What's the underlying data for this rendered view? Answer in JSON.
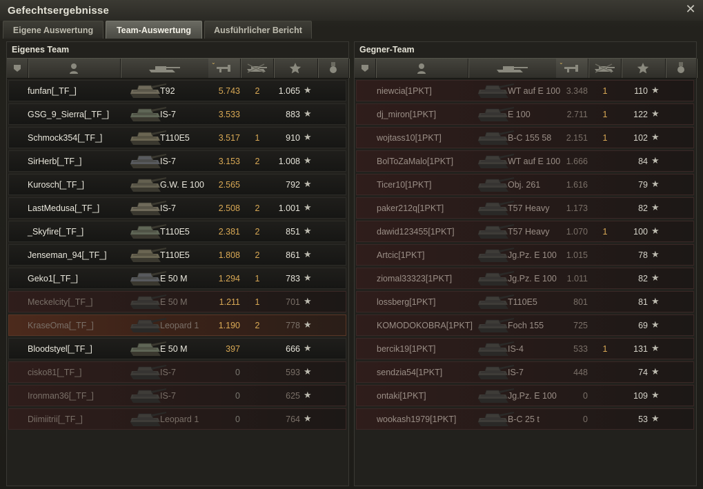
{
  "window": {
    "title": "Gefechtsergebnisse",
    "close_glyph": "✕"
  },
  "tabs": [
    {
      "label": "Eigene Auswertung",
      "active": false
    },
    {
      "label": "Team-Auswertung",
      "active": true
    },
    {
      "label": "Ausführlicher Bericht",
      "active": false
    }
  ],
  "own_team": {
    "title": "Eigenes Team",
    "rows": [
      {
        "name": "funfan[_TF_]",
        "vehicle": "T92",
        "damage": "5.743",
        "kills": "2",
        "xp": "1.065",
        "state": "alive"
      },
      {
        "name": "GSG_9_Sierra[_TF_]",
        "vehicle": "IS-7",
        "damage": "3.533",
        "kills": "",
        "xp": "883",
        "state": "alive"
      },
      {
        "name": "Schmock354[_TF_]",
        "vehicle": "T110E5",
        "damage": "3.517",
        "kills": "1",
        "xp": "910",
        "state": "alive"
      },
      {
        "name": "SirHerb[_TF_]",
        "vehicle": "IS-7",
        "damage": "3.153",
        "kills": "2",
        "xp": "1.008",
        "state": "alive"
      },
      {
        "name": "Kurosch[_TF_]",
        "vehicle": "G.W. E 100",
        "damage": "2.565",
        "kills": "",
        "xp": "792",
        "state": "alive"
      },
      {
        "name": "LastMedusa[_TF_]",
        "vehicle": "IS-7",
        "damage": "2.508",
        "kills": "2",
        "xp": "1.001",
        "state": "alive"
      },
      {
        "name": "_Skyfire[_TF_]",
        "vehicle": "T110E5",
        "damage": "2.381",
        "kills": "2",
        "xp": "851",
        "state": "alive"
      },
      {
        "name": "Jenseman_94[_TF_]",
        "vehicle": "T110E5",
        "damage": "1.808",
        "kills": "2",
        "xp": "861",
        "state": "alive"
      },
      {
        "name": "Geko1[_TF_]",
        "vehicle": "E 50 M",
        "damage": "1.294",
        "kills": "1",
        "xp": "783",
        "state": "alive"
      },
      {
        "name": "Meckelcity[_TF_]",
        "vehicle": "E 50 M",
        "damage": "1.211",
        "kills": "1",
        "xp": "701",
        "state": "dead"
      },
      {
        "name": "KraseOma[_TF_]",
        "vehicle": "Leopard 1",
        "damage": "1.190",
        "kills": "2",
        "xp": "778",
        "state": "dead-self"
      },
      {
        "name": "Bloodstyel[_TF_]",
        "vehicle": "E 50 M",
        "damage": "397",
        "kills": "",
        "xp": "666",
        "state": "alive"
      },
      {
        "name": "cisko81[_TF_]",
        "vehicle": "IS-7",
        "damage": "0",
        "kills": "",
        "xp": "593",
        "state": "dead"
      },
      {
        "name": "Ironman36[_TF_]",
        "vehicle": "IS-7",
        "damage": "0",
        "kills": "",
        "xp": "625",
        "state": "dead"
      },
      {
        "name": "Diimiitrii[_TF_]",
        "vehicle": "Leopard 1",
        "damage": "0",
        "kills": "",
        "xp": "764",
        "state": "dead"
      }
    ]
  },
  "enemy_team": {
    "title": "Gegner-Team",
    "rows": [
      {
        "name": "niewcia[1PKT]",
        "vehicle": "WT auf E 100",
        "damage": "3.348",
        "kills": "1",
        "xp": "110"
      },
      {
        "name": "dj_miron[1PKT]",
        "vehicle": "E 100",
        "damage": "2.711",
        "kills": "1",
        "xp": "122"
      },
      {
        "name": "wojtass10[1PKT]",
        "vehicle": "B-C 155 58",
        "damage": "2.151",
        "kills": "1",
        "xp": "102"
      },
      {
        "name": "BolToZaMalo[1PKT]",
        "vehicle": "WT auf E 100",
        "damage": "1.666",
        "kills": "",
        "xp": "84"
      },
      {
        "name": "Ticer10[1PKT]",
        "vehicle": "Obj. 261",
        "damage": "1.616",
        "kills": "",
        "xp": "79"
      },
      {
        "name": "paker212q[1PKT]",
        "vehicle": "T57 Heavy",
        "damage": "1.173",
        "kills": "",
        "xp": "82"
      },
      {
        "name": "dawid123455[1PKT]",
        "vehicle": "T57 Heavy",
        "damage": "1.070",
        "kills": "1",
        "xp": "100"
      },
      {
        "name": "Artcic[1PKT]",
        "vehicle": "Jg.Pz. E 100",
        "damage": "1.015",
        "kills": "",
        "xp": "78"
      },
      {
        "name": "ziomal33323[1PKT]",
        "vehicle": "Jg.Pz. E 100",
        "damage": "1.011",
        "kills": "",
        "xp": "82"
      },
      {
        "name": "lossberg[1PKT]",
        "vehicle": "T110E5",
        "damage": "801",
        "kills": "",
        "xp": "81"
      },
      {
        "name": "KOMODOKOBRA[1PKT]",
        "vehicle": "Foch 155",
        "damage": "725",
        "kills": "",
        "xp": "69"
      },
      {
        "name": "bercik19[1PKT]",
        "vehicle": "IS-4",
        "damage": "533",
        "kills": "1",
        "xp": "131"
      },
      {
        "name": "sendzia54[1PKT]",
        "vehicle": "IS-7",
        "damage": "448",
        "kills": "",
        "xp": "74"
      },
      {
        "name": "ontaki[1PKT]",
        "vehicle": "Jg.Pz. E 100",
        "damage": "0",
        "kills": "",
        "xp": "109"
      },
      {
        "name": "wookash1979[1PKT]",
        "vehicle": "B-C 25 t",
        "damage": "0",
        "kills": "",
        "xp": "53"
      }
    ]
  },
  "columns": [
    {
      "icon": "platoon-icon"
    },
    {
      "icon": "player-icon"
    },
    {
      "icon": "tank-icon"
    },
    {
      "icon": "damage-icon",
      "sorted": true
    },
    {
      "icon": "kills-icon"
    },
    {
      "icon": "xp-star-icon"
    },
    {
      "icon": "medal-icon"
    }
  ],
  "row_star_glyph": "★",
  "sort_glyph": "⌄"
}
